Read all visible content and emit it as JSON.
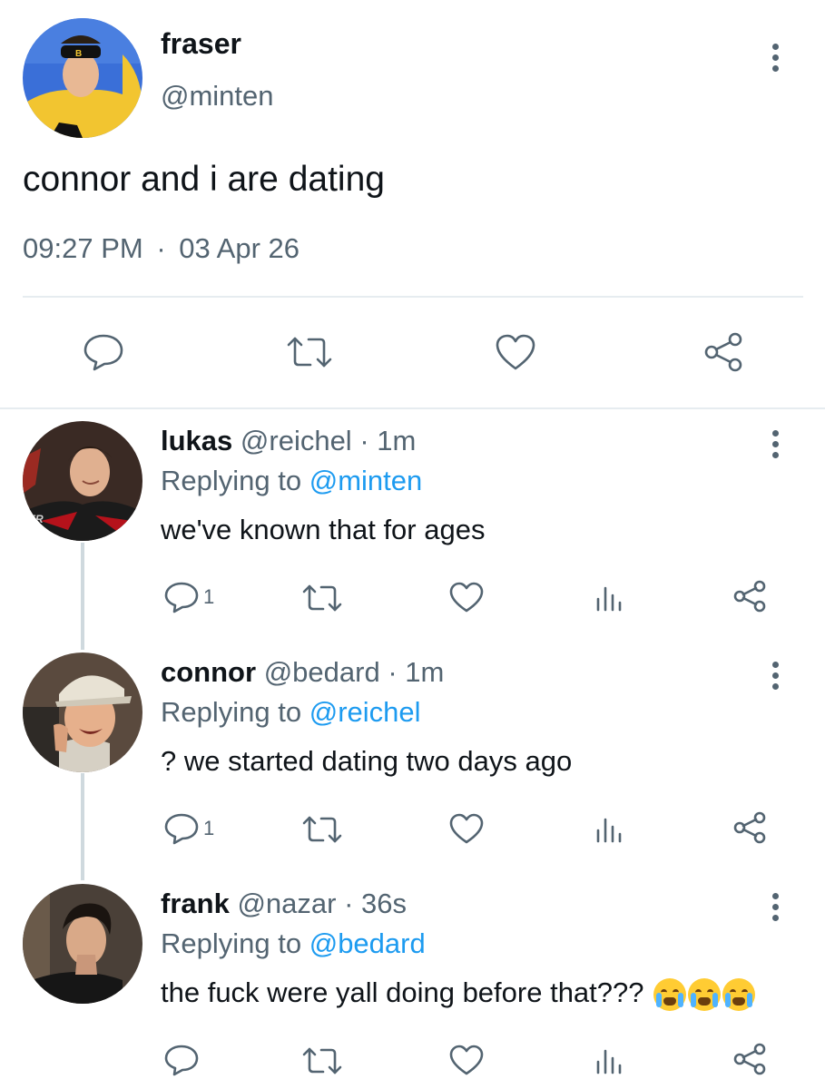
{
  "main_tweet": {
    "name": "fraser",
    "handle": "@minten",
    "text": "connor and i are dating",
    "time": "09:27 PM",
    "separator": "·",
    "date": "03 Apr 26",
    "avatar_colors": {
      "bg": "#f2c530",
      "skin": "#e8b894",
      "headband": "#111111"
    }
  },
  "replies": [
    {
      "name": "lukas",
      "handle": "@reichel",
      "dot": "·",
      "time": "1m",
      "replying_prefix": "Replying to",
      "replying_to": "@minten",
      "text": "we've known that for ages",
      "reply_count": "1",
      "avatar_colors": {
        "bg": "#3a2a24",
        "skin": "#e0b090",
        "jersey": "#b5121b"
      }
    },
    {
      "name": "connor",
      "handle": "@bedard",
      "dot": "·",
      "time": "1m",
      "replying_prefix": "Replying to",
      "replying_to": "@reichel",
      "text": "? we started dating two days ago",
      "reply_count": "1",
      "avatar_colors": {
        "bg": "#5a4a3e",
        "skin": "#e6b08c",
        "cap": "#e8e2d4"
      }
    },
    {
      "name": "frank",
      "handle": "@nazar",
      "dot": "·",
      "time": "36s",
      "replying_prefix": "Replying to",
      "replying_to": "@bedard",
      "text": "the fuck were yall doing before that???",
      "emojis": [
        "loudly-crying-face",
        "loudly-crying-face",
        "loudly-crying-face"
      ],
      "avatar_colors": {
        "bg": "#4a4038",
        "skin": "#d9a988",
        "hair": "#1a1410"
      }
    }
  ],
  "colors": {
    "text_primary": "#0f1419",
    "text_secondary": "#536471",
    "link": "#1d9bf0",
    "divider": "#e6ecf0",
    "thread_line": "#cfd9de"
  },
  "icons": {
    "reply": "reply-icon",
    "retweet": "retweet-icon",
    "like": "heart-icon",
    "views": "analytics-icon",
    "share": "share-icon",
    "more": "more-options-icon"
  }
}
